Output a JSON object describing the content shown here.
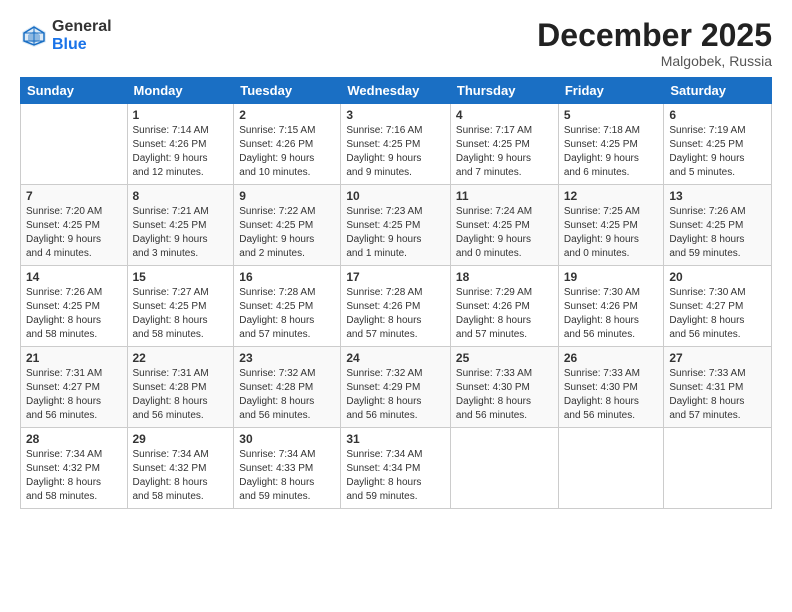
{
  "logo": {
    "general": "General",
    "blue": "Blue"
  },
  "title": "December 2025",
  "location": "Malgobek, Russia",
  "days_of_week": [
    "Sunday",
    "Monday",
    "Tuesday",
    "Wednesday",
    "Thursday",
    "Friday",
    "Saturday"
  ],
  "weeks": [
    [
      {
        "day": "",
        "info": ""
      },
      {
        "day": "1",
        "info": "Sunrise: 7:14 AM\nSunset: 4:26 PM\nDaylight: 9 hours\nand 12 minutes."
      },
      {
        "day": "2",
        "info": "Sunrise: 7:15 AM\nSunset: 4:26 PM\nDaylight: 9 hours\nand 10 minutes."
      },
      {
        "day": "3",
        "info": "Sunrise: 7:16 AM\nSunset: 4:25 PM\nDaylight: 9 hours\nand 9 minutes."
      },
      {
        "day": "4",
        "info": "Sunrise: 7:17 AM\nSunset: 4:25 PM\nDaylight: 9 hours\nand 7 minutes."
      },
      {
        "day": "5",
        "info": "Sunrise: 7:18 AM\nSunset: 4:25 PM\nDaylight: 9 hours\nand 6 minutes."
      },
      {
        "day": "6",
        "info": "Sunrise: 7:19 AM\nSunset: 4:25 PM\nDaylight: 9 hours\nand 5 minutes."
      }
    ],
    [
      {
        "day": "7",
        "info": "Sunrise: 7:20 AM\nSunset: 4:25 PM\nDaylight: 9 hours\nand 4 minutes."
      },
      {
        "day": "8",
        "info": "Sunrise: 7:21 AM\nSunset: 4:25 PM\nDaylight: 9 hours\nand 3 minutes."
      },
      {
        "day": "9",
        "info": "Sunrise: 7:22 AM\nSunset: 4:25 PM\nDaylight: 9 hours\nand 2 minutes."
      },
      {
        "day": "10",
        "info": "Sunrise: 7:23 AM\nSunset: 4:25 PM\nDaylight: 9 hours\nand 1 minute."
      },
      {
        "day": "11",
        "info": "Sunrise: 7:24 AM\nSunset: 4:25 PM\nDaylight: 9 hours\nand 0 minutes."
      },
      {
        "day": "12",
        "info": "Sunrise: 7:25 AM\nSunset: 4:25 PM\nDaylight: 9 hours\nand 0 minutes."
      },
      {
        "day": "13",
        "info": "Sunrise: 7:26 AM\nSunset: 4:25 PM\nDaylight: 8 hours\nand 59 minutes."
      }
    ],
    [
      {
        "day": "14",
        "info": "Sunrise: 7:26 AM\nSunset: 4:25 PM\nDaylight: 8 hours\nand 58 minutes."
      },
      {
        "day": "15",
        "info": "Sunrise: 7:27 AM\nSunset: 4:25 PM\nDaylight: 8 hours\nand 58 minutes."
      },
      {
        "day": "16",
        "info": "Sunrise: 7:28 AM\nSunset: 4:25 PM\nDaylight: 8 hours\nand 57 minutes."
      },
      {
        "day": "17",
        "info": "Sunrise: 7:28 AM\nSunset: 4:26 PM\nDaylight: 8 hours\nand 57 minutes."
      },
      {
        "day": "18",
        "info": "Sunrise: 7:29 AM\nSunset: 4:26 PM\nDaylight: 8 hours\nand 57 minutes."
      },
      {
        "day": "19",
        "info": "Sunrise: 7:30 AM\nSunset: 4:26 PM\nDaylight: 8 hours\nand 56 minutes."
      },
      {
        "day": "20",
        "info": "Sunrise: 7:30 AM\nSunset: 4:27 PM\nDaylight: 8 hours\nand 56 minutes."
      }
    ],
    [
      {
        "day": "21",
        "info": "Sunrise: 7:31 AM\nSunset: 4:27 PM\nDaylight: 8 hours\nand 56 minutes."
      },
      {
        "day": "22",
        "info": "Sunrise: 7:31 AM\nSunset: 4:28 PM\nDaylight: 8 hours\nand 56 minutes."
      },
      {
        "day": "23",
        "info": "Sunrise: 7:32 AM\nSunset: 4:28 PM\nDaylight: 8 hours\nand 56 minutes."
      },
      {
        "day": "24",
        "info": "Sunrise: 7:32 AM\nSunset: 4:29 PM\nDaylight: 8 hours\nand 56 minutes."
      },
      {
        "day": "25",
        "info": "Sunrise: 7:33 AM\nSunset: 4:30 PM\nDaylight: 8 hours\nand 56 minutes."
      },
      {
        "day": "26",
        "info": "Sunrise: 7:33 AM\nSunset: 4:30 PM\nDaylight: 8 hours\nand 56 minutes."
      },
      {
        "day": "27",
        "info": "Sunrise: 7:33 AM\nSunset: 4:31 PM\nDaylight: 8 hours\nand 57 minutes."
      }
    ],
    [
      {
        "day": "28",
        "info": "Sunrise: 7:34 AM\nSunset: 4:32 PM\nDaylight: 8 hours\nand 58 minutes."
      },
      {
        "day": "29",
        "info": "Sunrise: 7:34 AM\nSunset: 4:32 PM\nDaylight: 8 hours\nand 58 minutes."
      },
      {
        "day": "30",
        "info": "Sunrise: 7:34 AM\nSunset: 4:33 PM\nDaylight: 8 hours\nand 59 minutes."
      },
      {
        "day": "31",
        "info": "Sunrise: 7:34 AM\nSunset: 4:34 PM\nDaylight: 8 hours\nand 59 minutes."
      },
      {
        "day": "",
        "info": ""
      },
      {
        "day": "",
        "info": ""
      },
      {
        "day": "",
        "info": ""
      }
    ]
  ]
}
